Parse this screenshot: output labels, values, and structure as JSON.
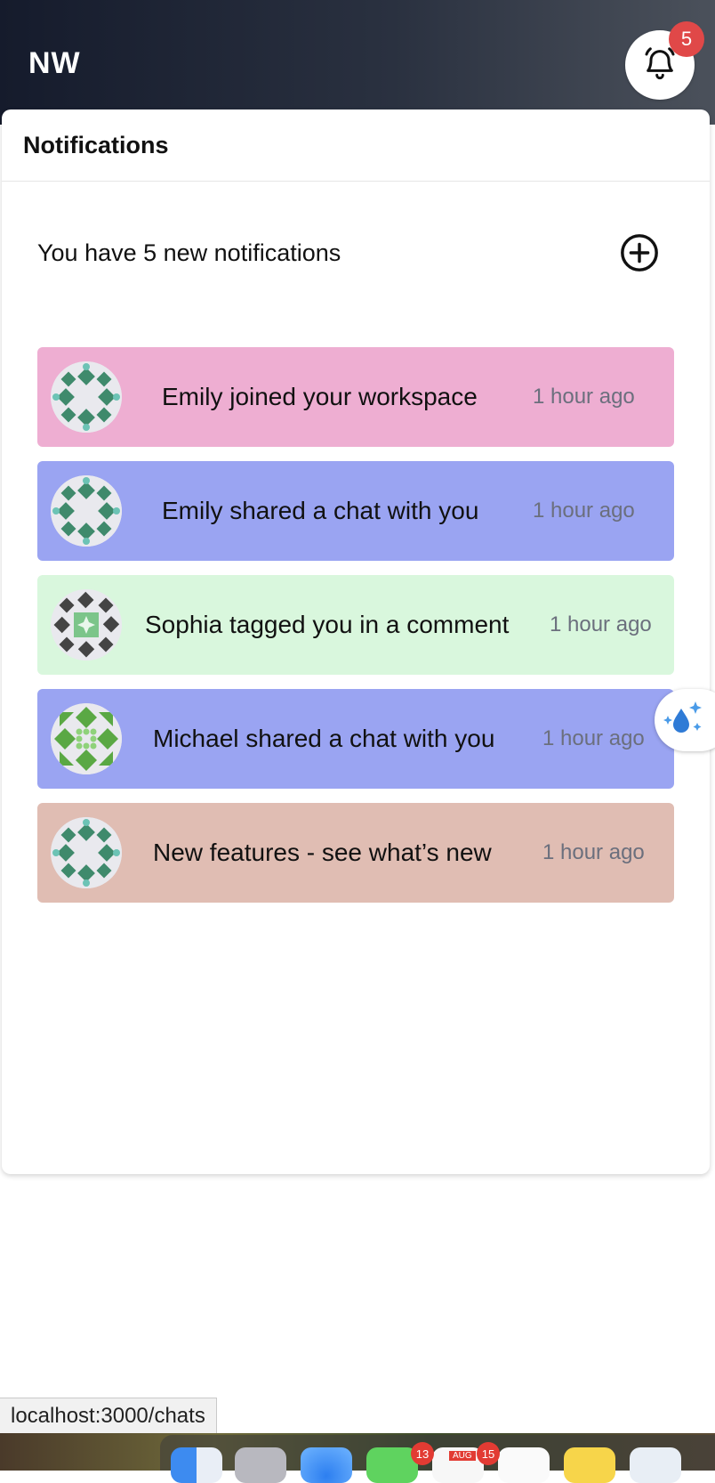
{
  "app": {
    "logo_text": "NW"
  },
  "header": {
    "notification_count": "5"
  },
  "panel": {
    "title": "Notifications",
    "summary": "You have 5 new notifications",
    "add_icon": "plus-circle-icon"
  },
  "notifications": [
    {
      "text": "Emily joined your workspace",
      "time": "1 hour ago",
      "bg": "#eeaed2"
    },
    {
      "text": "Emily shared a chat with you",
      "time": "1 hour ago",
      "bg": "#9aa4f2"
    },
    {
      "text": "Sophia tagged you in a comment",
      "time": "1 hour ago",
      "bg": "#d9f7dd"
    },
    {
      "text": "Michael shared a chat with you",
      "time": "1 hour ago",
      "bg": "#9aa4f2"
    },
    {
      "text": "New features - see what’s new",
      "time": "1 hour ago",
      "bg": "#e0bdb3"
    }
  ],
  "status_bar": {
    "url": "localhost:3000/chats"
  },
  "dock": {
    "messages_badge": "13",
    "calendar_badge": "15",
    "calendar_month": "AUG"
  }
}
